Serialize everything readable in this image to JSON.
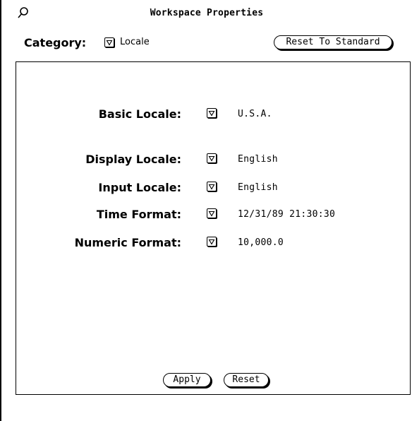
{
  "window": {
    "title": "Workspace Properties"
  },
  "category": {
    "label": "Category:",
    "value": "Locale"
  },
  "buttons": {
    "reset_to_standard": "Reset To Standard",
    "apply": "Apply",
    "reset": "Reset"
  },
  "settings": [
    {
      "label": "Basic Locale:",
      "value": "U.S.A."
    },
    {
      "label": "Display Locale:",
      "value": "English"
    },
    {
      "label": "Input Locale:",
      "value": "English"
    },
    {
      "label": "Time Format:",
      "value": "12/31/89 21:30:30"
    },
    {
      "label": "Numeric Format:",
      "value": "10,000.0"
    }
  ],
  "icons": {
    "pin": "pushpin-icon",
    "menu": "menu-triangle-icon"
  }
}
